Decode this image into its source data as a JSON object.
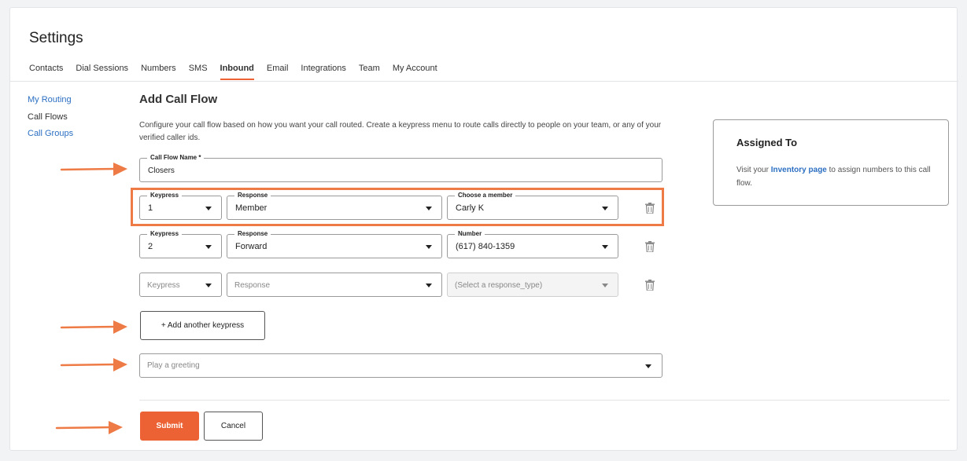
{
  "page": {
    "title": "Settings"
  },
  "tabs": [
    {
      "label": "Contacts"
    },
    {
      "label": "Dial Sessions"
    },
    {
      "label": "Numbers"
    },
    {
      "label": "SMS"
    },
    {
      "label": "Inbound",
      "active": true
    },
    {
      "label": "Email"
    },
    {
      "label": "Integrations"
    },
    {
      "label": "Team"
    },
    {
      "label": "My Account"
    }
  ],
  "sidebar": {
    "items": [
      {
        "label": "My Routing"
      },
      {
        "label": "Call Flows",
        "current": true
      },
      {
        "label": "Call Groups"
      }
    ]
  },
  "form": {
    "heading": "Add Call Flow",
    "description": "Configure your call flow based on how you want your call routed. Create a keypress menu to route calls directly to people on your team, or any of your verified caller ids.",
    "name_label": "Call Flow Name *",
    "name_value": "Closers",
    "rows": [
      {
        "keypress_label": "Keypress",
        "keypress": "1",
        "response_label": "Response",
        "response": "Member",
        "target_label": "Choose a member",
        "target": "Carly K"
      },
      {
        "keypress_label": "Keypress",
        "keypress": "2",
        "response_label": "Response",
        "response": "Forward",
        "target_label": "Number",
        "target": "(617) 840-1359"
      },
      {
        "keypress_placeholder": "Keypress",
        "response_placeholder": "Response",
        "target_placeholder": "(Select a response_type)"
      }
    ],
    "add_keypress_label": "+ Add another keypress",
    "greeting_placeholder": "Play a greeting",
    "submit_label": "Submit",
    "cancel_label": "Cancel"
  },
  "assigned": {
    "title": "Assigned To",
    "text_before": "Visit your ",
    "link": "Inventory page",
    "text_after": " to assign numbers to this call flow."
  },
  "colors": {
    "accent": "#ec6234",
    "link": "#2c6fc2",
    "annotation": "#ee7a45"
  },
  "icons": [
    "trash-icon",
    "chevron-down-icon",
    "annotation-arrow-icon"
  ]
}
